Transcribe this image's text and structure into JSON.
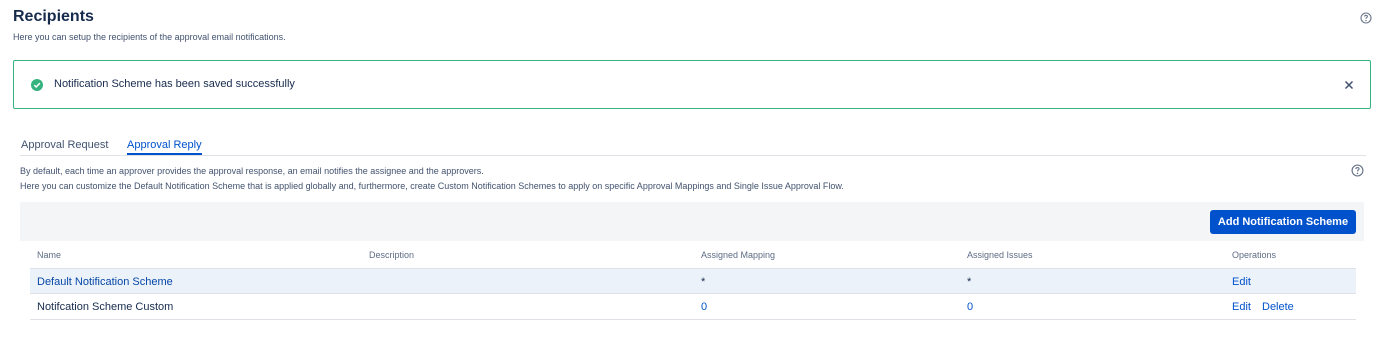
{
  "header": {
    "title": "Recipients",
    "subtitle": "Here you can setup the recipients of the approval email notifications."
  },
  "flag": {
    "message": "Notification Scheme has been saved successfully",
    "status_color": "#36b37e"
  },
  "tabs": [
    {
      "label": "Approval Request",
      "active": false
    },
    {
      "label": "Approval Reply",
      "active": true
    }
  ],
  "description": {
    "line1": "By default, each time an approver provides the approval response, an email notifies the assignee and the approvers.",
    "line2": "Here you can customize the Default Notification Scheme that is applied globally and, furthermore, create Custom Notification Schemes to apply on specific Approval Mappings and Single Issue Approval Flow."
  },
  "toolbar": {
    "add_label": "Add Notification Scheme"
  },
  "table": {
    "columns": [
      "Name",
      "Description",
      "Assigned Mapping",
      "Assigned Issues",
      "Operations"
    ],
    "rows": [
      {
        "name": "Default Notification Scheme",
        "description": "",
        "mapping": "*",
        "issues": "*",
        "ops": [
          "Edit"
        ]
      },
      {
        "name": "Notifcation Scheme Custom",
        "description": "",
        "mapping": "0",
        "issues": "0",
        "ops": [
          "Edit",
          "Delete"
        ]
      }
    ]
  },
  "colors": {
    "primary": "#0052cc",
    "success": "#36b37e",
    "highlight_row": "#ebf2fa"
  }
}
